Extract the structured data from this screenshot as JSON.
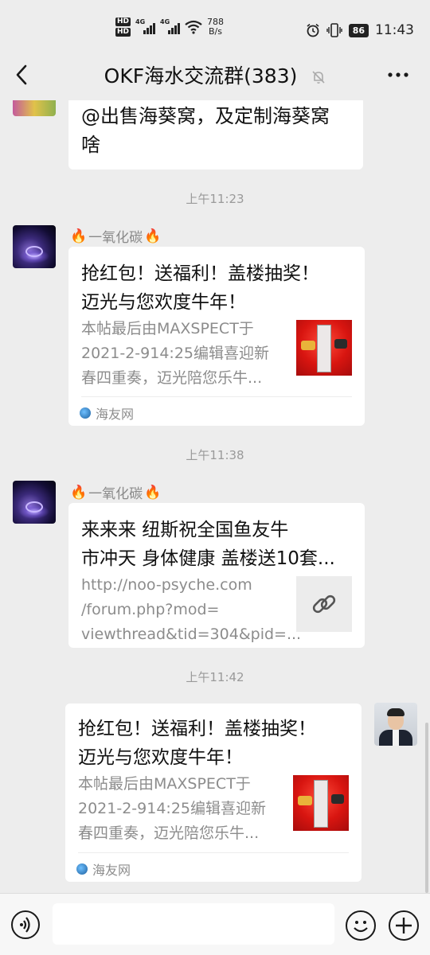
{
  "status_bar": {
    "hd1": "HD",
    "hd2": "HD",
    "net1": "4G",
    "net2": "4G",
    "speed_value": "788",
    "speed_unit": "B/s",
    "battery": "86",
    "time": "11:43"
  },
  "header": {
    "title": "OKF海水交流群(383)"
  },
  "messages": [
    {
      "type": "text",
      "text_line1": "@出售海葵窝，及定制海葵窝",
      "text_line2": "啥"
    },
    {
      "type": "time",
      "text": "上午11:23"
    },
    {
      "type": "card",
      "sender": "一氧化碳",
      "title_line1": "抢红包！送福利！盖楼抽奖！",
      "title_line2": "迈光与您欢度牛年！",
      "desc_line1": "本帖最后由MAXSPECT于",
      "desc_line2": "2021-2-914:25编辑喜迎新",
      "desc_line3": "春四重奏，迈光陪您乐牛...",
      "source": "海友网"
    },
    {
      "type": "time",
      "text": "上午11:38"
    },
    {
      "type": "link",
      "sender": "一氧化碳",
      "title_line1": "来来来 纽斯祝全国鱼友牛",
      "title_line2": "市冲天 身体健康 盖楼送10套...",
      "url_line1": "http://noo-psyche.com",
      "url_line2": "/forum.php?mod=",
      "url_line3": "viewthread&tid=304&pid=..."
    },
    {
      "type": "time",
      "text": "上午11:42"
    },
    {
      "type": "card_self",
      "title_line1": "抢红包！送福利！盖楼抽奖！",
      "title_line2": "迈光与您欢度牛年！",
      "desc_line1": "本帖最后由MAXSPECT于",
      "desc_line2": "2021-2-914:25编辑喜迎新",
      "desc_line3": "春四重奏，迈光陪您乐牛...",
      "source": "海友网"
    }
  ],
  "icons": {
    "back": "chevron-left-icon",
    "mute": "bell-off-icon",
    "more": "more-horizontal-icon",
    "sender_badge": "fire-icon",
    "link": "link-icon",
    "voice": "voice-icon",
    "emoji": "emoji-icon",
    "plus": "plus-icon"
  }
}
